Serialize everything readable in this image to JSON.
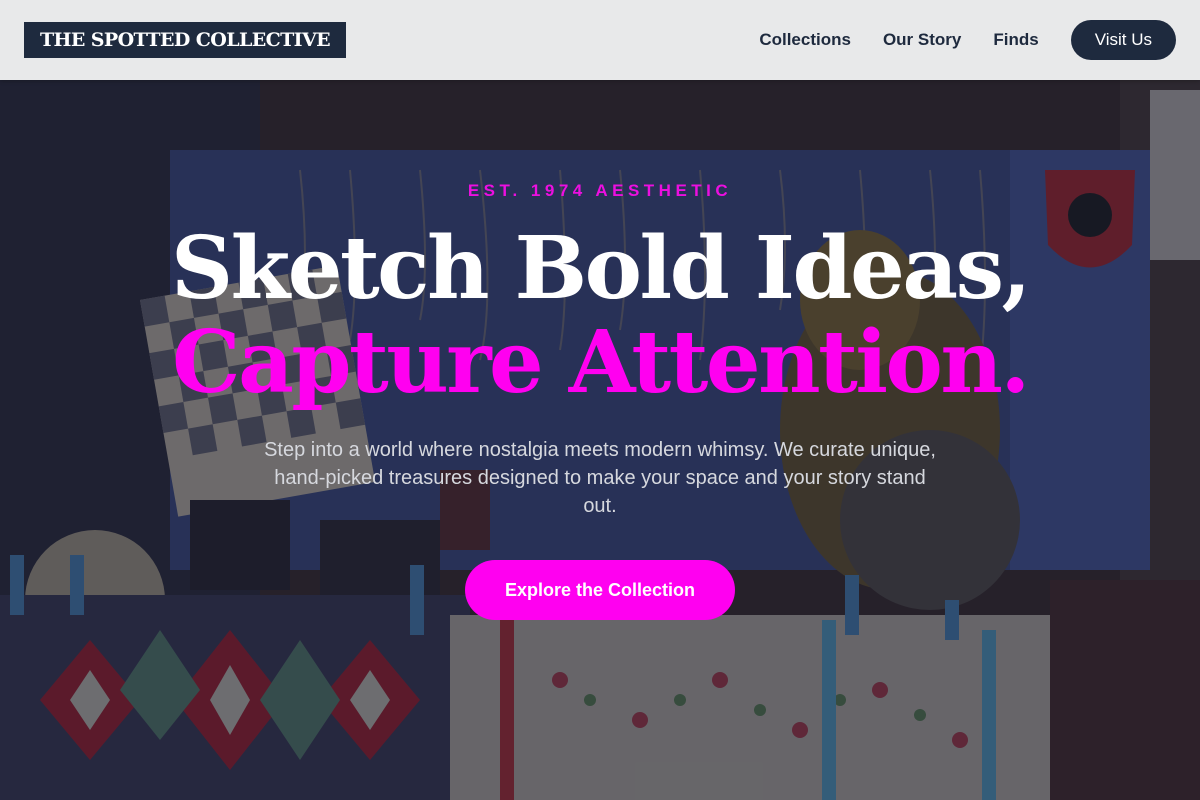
{
  "header": {
    "logo_text": "THE SPOTTED COLLECTIVE",
    "nav": [
      {
        "label": "Collections"
      },
      {
        "label": "Our Story"
      },
      {
        "label": "Finds"
      }
    ],
    "visit_button": "Visit Us"
  },
  "hero": {
    "eyebrow": "EST. 1974 AESTHETIC",
    "headline_line1": "Sketch Bold Ideas,",
    "headline_line2": "Capture Attention.",
    "subtext": "Step into a world where nostalgia meets modern whimsy. We curate unique, hand-picked treasures designed to make your space and your story stand out.",
    "cta_label": "Explore the Collection",
    "background_image": "market-stall-photo"
  },
  "colors": {
    "brand_navy": "#1e2a3e",
    "accent_magenta": "#ff00f0",
    "eyebrow_magenta": "#ec0fe0",
    "header_bg": "#eeeff1"
  }
}
